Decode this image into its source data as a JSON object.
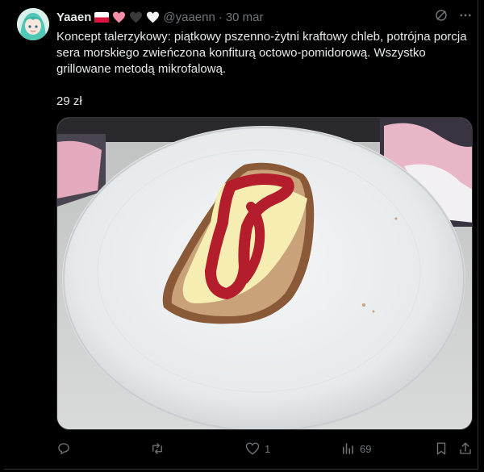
{
  "tweet": {
    "author_name": "Yaaen",
    "handle": "@yaaenn",
    "separator": "·",
    "date": "30 mar",
    "text": "Koncept talerzykowy: piątkowy pszenno-żytni kraftowy chleb, potrójna porcja sera morskiego zwieńczona konfiturą octowo-pomidorową. Wszystko grillowane metodą mikrofalową.",
    "price": "29 zł",
    "badges": [
      "flag-poland-icon",
      "pink-heart-icon",
      "black-heart-icon",
      "white-heart-icon"
    ]
  },
  "actions": {
    "reply_count": "",
    "retweet_count": "",
    "like_count": "1",
    "views_count": "69"
  },
  "icons": {
    "top": [
      "grok-icon",
      "more-options-icon"
    ],
    "bottom": [
      "reply-icon",
      "retweet-icon",
      "like-icon",
      "views-icon",
      "bookmark-icon",
      "share-icon"
    ]
  },
  "colors": {
    "background": "#000000",
    "text": "#e7e9ea",
    "secondary": "#71767b",
    "border": "#2f3336"
  }
}
